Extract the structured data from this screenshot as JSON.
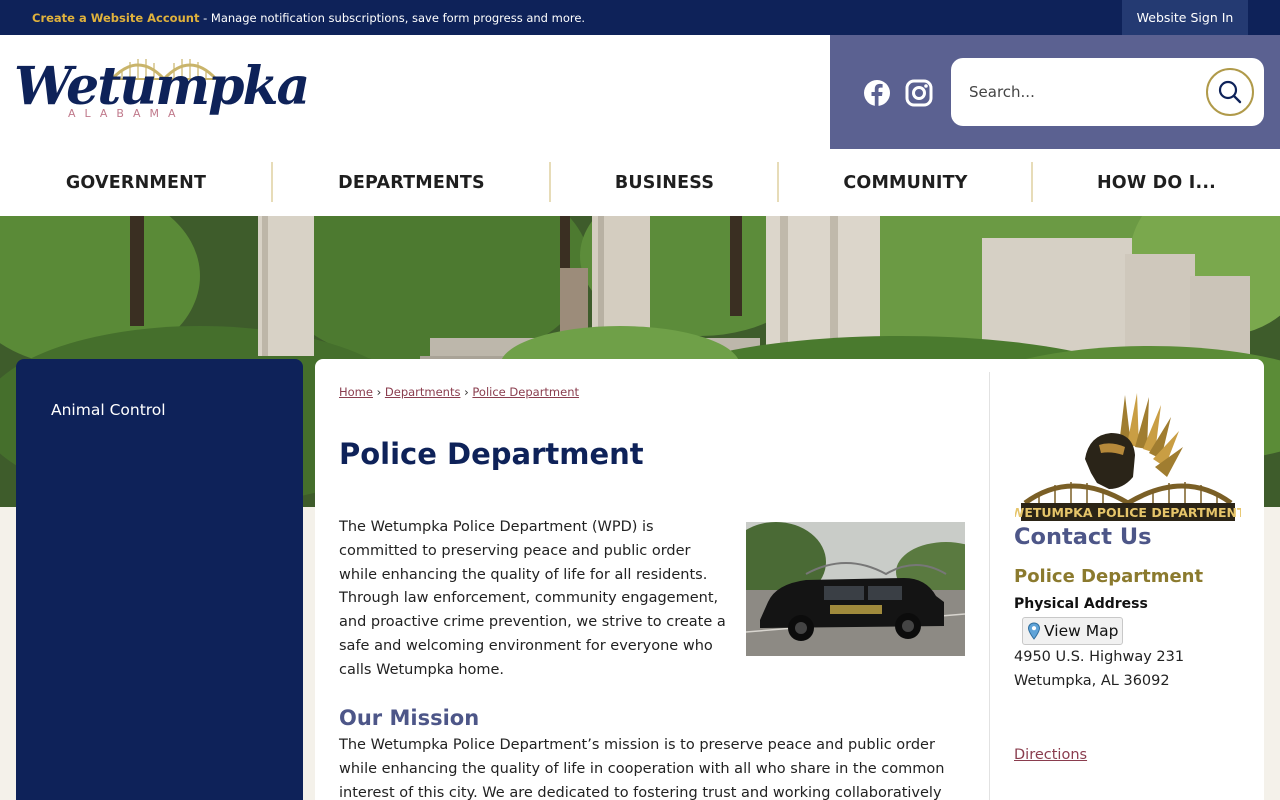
{
  "topbar": {
    "account_link": "Create a Website Account",
    "account_text": " - Manage notification subscriptions, save form progress and more.",
    "sign_in": "Website Sign In"
  },
  "logo": {
    "script": "Wetumpka",
    "state": "ALABAMA"
  },
  "social": {
    "facebook": "facebook-icon",
    "instagram": "instagram-icon"
  },
  "search": {
    "placeholder": "Search..."
  },
  "nav": {
    "items": [
      "GOVERNMENT",
      "DEPARTMENTS",
      "BUSINESS",
      "COMMUNITY",
      "HOW DO I..."
    ]
  },
  "sidebar": {
    "items": [
      "Animal Control"
    ]
  },
  "breadcrumb": {
    "home": "Home",
    "departments": "Departments",
    "current": "Police Department",
    "separator": "›"
  },
  "page": {
    "title": "Police Department",
    "intro": "The Wetumpka Police Department (WPD) is committed to preserving peace and public order while enhancing the quality of life for all residents. Through law enforcement, community engagement, and proactive crime prevention, we strive to create a safe and welcoming environment for everyone who calls Wetumpka home.",
    "mission_title": "Our Mission",
    "mission_text": "The Wetumpka Police Department’s mission is to preserve peace and public order while enhancing the quality of life in cooperation with all who share in the common interest of this city. We are dedicated to fostering trust and working collaboratively with the"
  },
  "contact": {
    "badge_text": "WETUMPKA POLICE DEPARTMENT",
    "title": "Contact Us",
    "dept": "Police Department",
    "address_label": "Physical Address",
    "map_button": "View Map",
    "address_line1": "4950 U.S. Highway 231",
    "address_line2": "Wetumpka, AL 36092",
    "directions": "Directions"
  },
  "colors": {
    "navy": "#0e2259",
    "gold": "#e0b23c",
    "slate": "#5b6191",
    "link": "#8a3d4e",
    "olive": "#8b7a2e"
  }
}
